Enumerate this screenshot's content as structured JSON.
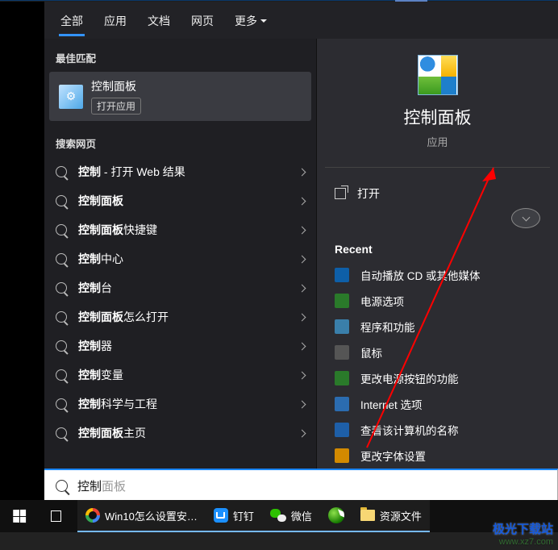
{
  "tabs": {
    "all": "全部",
    "apps": "应用",
    "docs": "文档",
    "web": "网页",
    "more": "更多"
  },
  "sections": {
    "best": "最佳匹配",
    "web": "搜索网页"
  },
  "best": {
    "title": "控制面板",
    "open": "打开应用"
  },
  "webRows": [
    {
      "prefix": "",
      "bold": "控制",
      "suffix": " - 打开 Web 结果"
    },
    {
      "prefix": "",
      "bold": "控制面板",
      "suffix": ""
    },
    {
      "prefix": "",
      "bold": "控制面板",
      "suffix": "快捷键"
    },
    {
      "prefix": "",
      "bold": "控制",
      "suffix": "中心"
    },
    {
      "prefix": "",
      "bold": "控制",
      "suffix": "台"
    },
    {
      "prefix": "",
      "bold": "控制面板",
      "suffix": "怎么打开"
    },
    {
      "prefix": "",
      "bold": "控制",
      "suffix": "器"
    },
    {
      "prefix": "",
      "bold": "控制",
      "suffix": "变量"
    },
    {
      "prefix": "",
      "bold": "控制",
      "suffix": "科学与工程"
    },
    {
      "prefix": "",
      "bold": "控制面板",
      "suffix": "主页"
    }
  ],
  "details": {
    "title": "控制面板",
    "sub": "应用",
    "open": "打开",
    "recent": "Recent"
  },
  "recent": [
    {
      "label": "自动播放 CD 或其他媒体",
      "color": "#0e5fa8"
    },
    {
      "label": "电源选项",
      "color": "#2a7a2a"
    },
    {
      "label": "程序和功能",
      "color": "#3a7faa"
    },
    {
      "label": "鼠标",
      "color": "#555"
    },
    {
      "label": "更改电源按钮的功能",
      "color": "#2a7a2a"
    },
    {
      "label": "Internet 选项",
      "color": "#2b6cb0"
    },
    {
      "label": "查看该计算机的名称",
      "color": "#1e5fa8"
    },
    {
      "label": "更改字体设置",
      "color": "#d38a00"
    }
  ],
  "search": {
    "typed": "控制",
    "hint": "面板"
  },
  "taskbar": {
    "win10": "Win10怎么设置安…",
    "dingtalk": "钉钉",
    "wechat": "微信",
    "folder": "资源文件"
  },
  "watermark": {
    "line1": "极光下载站",
    "line2": "www.xz7.com"
  }
}
